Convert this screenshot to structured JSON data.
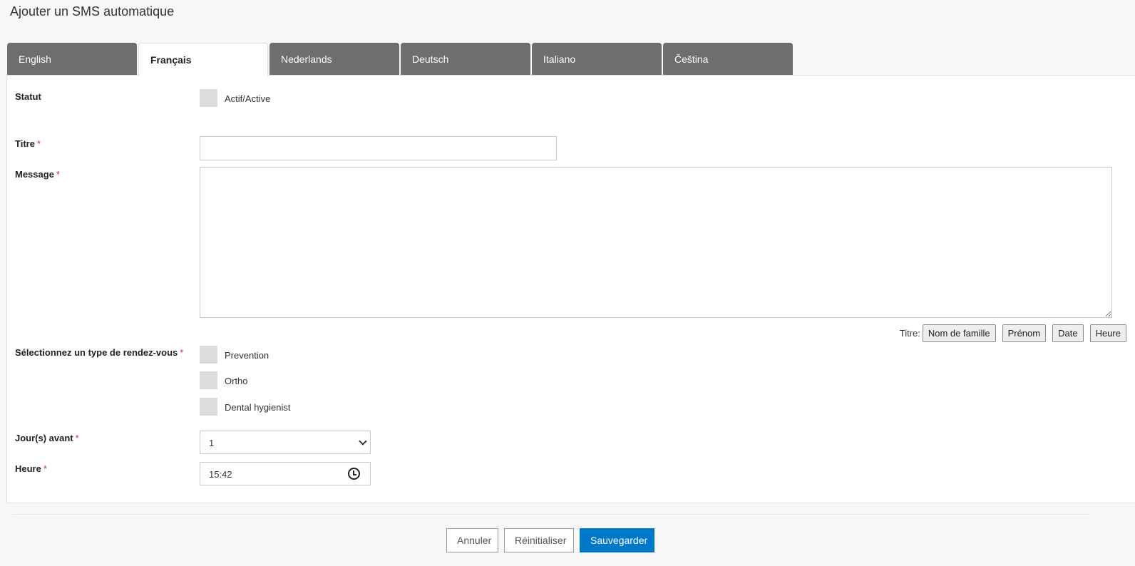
{
  "page": {
    "title": "Ajouter un SMS automatique"
  },
  "tabs": [
    {
      "label": "English",
      "active": false
    },
    {
      "label": "Français",
      "active": true
    },
    {
      "label": "Nederlands",
      "active": false
    },
    {
      "label": "Deutsch",
      "active": false
    },
    {
      "label": "Italiano",
      "active": false
    },
    {
      "label": "Čeština",
      "active": false
    }
  ],
  "form": {
    "status": {
      "label": "Statut",
      "checkbox_label": "Actif/Active",
      "checked": false
    },
    "title": {
      "label": "Titre",
      "required_mark": "*",
      "value": ""
    },
    "message": {
      "label": "Message",
      "required_mark": "*",
      "value": ""
    },
    "variables": {
      "label": "Titre:",
      "buttons": [
        "Nom de famille",
        "Prénom",
        "Date",
        "Heure"
      ]
    },
    "appointment_type": {
      "label": "Sélectionnez un type de rendez-vous",
      "required_mark": "*",
      "options": [
        {
          "label": "Prevention",
          "checked": false
        },
        {
          "label": "Ortho",
          "checked": false
        },
        {
          "label": "Dental hygienist",
          "checked": false
        }
      ]
    },
    "days_before": {
      "label": "Jour(s) avant",
      "required_mark": "*",
      "value": "1"
    },
    "time": {
      "label": "Heure",
      "required_mark": "*",
      "value": "15:42"
    }
  },
  "footer": {
    "cancel_label": "Annuler",
    "reset_label": "Réinitialiser",
    "save_label": "Sauvegarder"
  },
  "colors": {
    "primary": "#0078c8",
    "tab_inactive": "#6e6e6e",
    "required": "#c0392b"
  },
  "icons": {
    "time": "clock-icon",
    "select": "chevron-down-icon"
  }
}
